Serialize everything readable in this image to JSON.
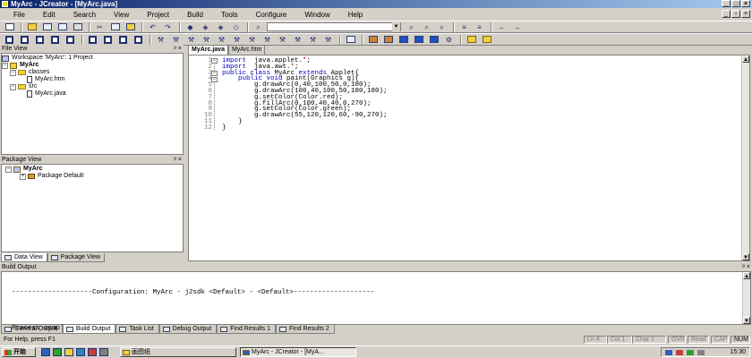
{
  "window": {
    "title": "MyArc - JCreator - [MyArc.java]"
  },
  "menu": [
    "File",
    "Edit",
    "Search",
    "View",
    "Project",
    "Build",
    "Tools",
    "Configure",
    "Window",
    "Help"
  ],
  "file_view": {
    "title": "File View",
    "workspace": "Workspace 'MyArc': 1 Project",
    "project": "MyArc",
    "folders": [
      {
        "name": "classes",
        "files": [
          "MyArc.htm"
        ]
      },
      {
        "name": "src",
        "files": [
          "MyArc.java"
        ]
      }
    ]
  },
  "package_view": {
    "title": "Package View",
    "project": "MyArc",
    "package": "Package Default"
  },
  "side_tabs": [
    "Data View",
    "Package View"
  ],
  "editor": {
    "tabs": [
      "MyArc.java",
      "MyArc.htm"
    ],
    "lines": [
      [
        [
          "kw",
          "import"
        ],
        [
          "",
          "  java.applet."
        ],
        [
          "op",
          "*"
        ],
        [
          "",
          ";"
        ]
      ],
      [
        [
          "kw",
          "import"
        ],
        [
          "",
          "  java.awt."
        ],
        [
          "op",
          "*"
        ],
        [
          "",
          ";"
        ]
      ],
      [
        [
          "kw",
          "public class"
        ],
        [
          "",
          " MyArc "
        ],
        [
          "kw",
          "extends"
        ],
        [
          "",
          " Applet{"
        ]
      ],
      [
        [
          "",
          "    "
        ],
        [
          "kw",
          "public void"
        ],
        [
          "",
          " paint(Graphics g){"
        ]
      ],
      [
        [
          "",
          "        g.drawArc(0,40,100,50,0,180);"
        ]
      ],
      [
        [
          "",
          "        g.drawArc(100,40,100,50,180,180);"
        ]
      ],
      [
        [
          "",
          "        g.setColor(Color.red);"
        ]
      ],
      [
        [
          "",
          "        g.fillArc(0,100,40,40,0,270);"
        ]
      ],
      [
        [
          "",
          "        g.setColor(Color.green);"
        ]
      ],
      [
        [
          "",
          "        g.drawArc(55,120,120,60,-90,270);"
        ]
      ],
      [
        [
          "",
          "    }"
        ]
      ],
      [
        [
          "",
          "}"
        ]
      ]
    ]
  },
  "build_output": {
    "title": "Build Output",
    "lines": [
      "--------------------Configuration: MyArc - j2sdk <Default> - <Default>--------------------",
      "",
      "Process completed."
    ]
  },
  "bottom_tabs": [
    "General Output",
    "Build Output",
    "Task List",
    "Debug Output",
    "Find Results 1",
    "Find Results 2"
  ],
  "status": {
    "message": "For Help, press F1",
    "ln": "Ln 4",
    "col": "Col 1",
    "char": "Char 1",
    "ovr": "OVR",
    "read": "Read",
    "cap": "CAP",
    "num": "NUM"
  },
  "taskbar": {
    "start": "开始",
    "tasks": [
      "画图纸",
      "MyArc - JCreator - [MyA..."
    ],
    "clock": "15:30"
  }
}
